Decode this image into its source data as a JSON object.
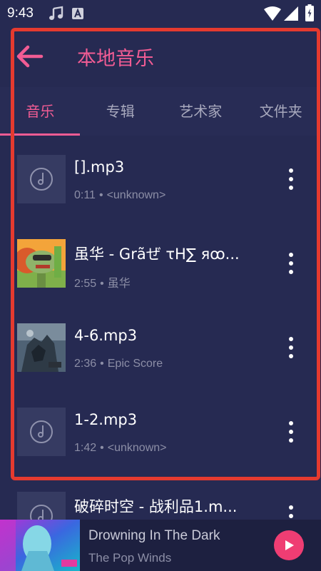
{
  "status_bar": {
    "time": "9:43",
    "icons": [
      "music-note-icon",
      "font-a-icon",
      "wifi-icon",
      "signal-icon",
      "battery-icon"
    ]
  },
  "header": {
    "title": "本地音乐",
    "back_icon": "arrow-left-icon"
  },
  "tabs": [
    {
      "label": "音乐",
      "active": true
    },
    {
      "label": "专辑",
      "active": false
    },
    {
      "label": "艺术家",
      "active": false
    },
    {
      "label": "文件夹",
      "active": false
    }
  ],
  "songs": [
    {
      "title": "[].mp3",
      "duration": "0:11",
      "separator": "•",
      "artist": "<unknown>",
      "art": "music-disc-icon"
    },
    {
      "title": "虽华 - Grãぜ τΗ∑ яꝏ...",
      "duration": "2:55",
      "separator": "•",
      "artist": "虽华",
      "art": "album-art"
    },
    {
      "title": "4-6.mp3",
      "duration": "2:36",
      "separator": "•",
      "artist": "Epic Score",
      "art": "album-art"
    },
    {
      "title": "1-2.mp3",
      "duration": "1:42",
      "separator": "•",
      "artist": "<unknown>",
      "art": "music-disc-icon"
    },
    {
      "title": "破碎时空 - 战利品1.m...",
      "duration": "",
      "separator": "",
      "artist": "",
      "art": "music-disc-icon"
    }
  ],
  "now_playing": {
    "title": "Drowning In The Dark",
    "artist": "The Pop Winds",
    "play_icon": "play-icon"
  },
  "colors": {
    "background": "#262a52",
    "accent": "#f25c94",
    "play_button": "#ef3d73",
    "selection_border": "#e53a2f"
  }
}
